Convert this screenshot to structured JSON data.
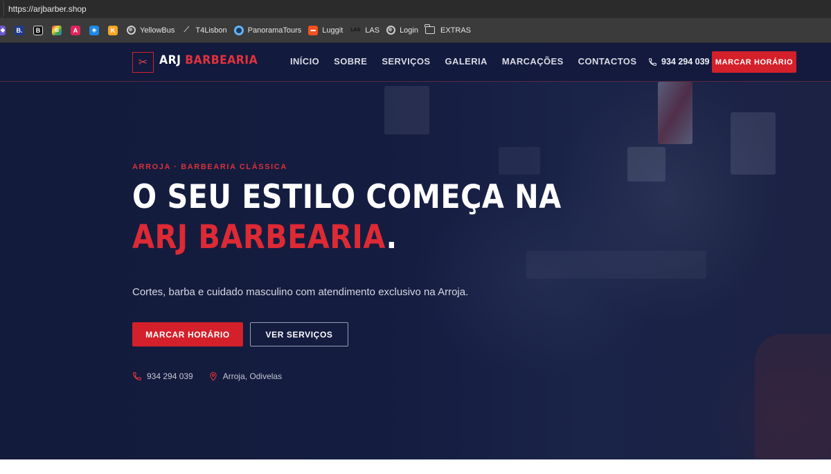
{
  "browser": {
    "url": "https://arjbarber.shop",
    "bookmarks": [
      {
        "label": "",
        "icon": "app-icon-1",
        "color": "#6a5acd",
        "glyph": "◆"
      },
      {
        "label": "",
        "icon": "booking-icon",
        "color": "#1f3a8a",
        "glyph": "B."
      },
      {
        "label": "",
        "icon": "notion-icon",
        "color": "#111111",
        "glyph": "B"
      },
      {
        "label": "",
        "icon": "colorful-icon",
        "color": "#2e7d32",
        "glyph": "≋"
      },
      {
        "label": "",
        "icon": "airbnb-icon",
        "color": "#e0245e",
        "glyph": "A"
      },
      {
        "label": "",
        "icon": "tool-icon",
        "color": "#1e88e5",
        "glyph": "◈"
      },
      {
        "label": "",
        "icon": "k-icon",
        "color": "#f5a623",
        "glyph": "K"
      },
      {
        "label": "YellowBus",
        "icon": "globe-icon"
      },
      {
        "label": "T4Lisbon",
        "icon": "pen-icon"
      },
      {
        "label": "PanoramaTours",
        "icon": "circle-icon"
      },
      {
        "label": "Luggit",
        "icon": "luggit-icon"
      },
      {
        "label": "LAS",
        "icon": "las-icon"
      },
      {
        "label": "Login",
        "icon": "globe-icon"
      },
      {
        "label": "EXTRAS",
        "icon": "folder-icon"
      }
    ]
  },
  "site": {
    "logo": {
      "part1": "ARJ",
      "part2": "BARBEARIA",
      "icon": "scissors-icon"
    },
    "nav": [
      "INÍCIO",
      "SOBRE",
      "SERVIÇOS",
      "GALERIA",
      "MARCAÇÕES",
      "CONTACTOS"
    ],
    "phone": "934 294 039",
    "nav_cta": "MARCAR HORÁRIO",
    "hero": {
      "eyebrow": "ARROJA · BARBEARIA CLÁSSICA",
      "headline_white": "O SEU ESTILO COMEÇA NA",
      "headline_red": "ARJ BARBEARIA",
      "headline_dot": ".",
      "subtitle": "Cortes, barba e cuidado masculino com atendimento exclusivo na Arroja.",
      "primary_button": "MARCAR HORÁRIO",
      "secondary_button": "VER SERVIÇOS",
      "phone": "934 294 039",
      "location": "Arroja, Odivelas"
    },
    "colors": {
      "accent": "#d3202b",
      "background": "#141c40"
    }
  }
}
